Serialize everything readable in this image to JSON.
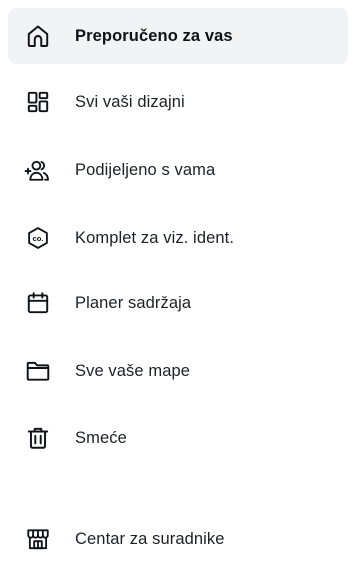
{
  "nav": {
    "items": [
      {
        "label": "Preporučeno za vas",
        "icon": "home-icon",
        "active": true
      },
      {
        "label": "Svi vaši dizajni",
        "icon": "grid-icon",
        "active": false
      },
      {
        "label": "Podijeljeno s vama",
        "icon": "shared-users-icon",
        "active": false
      },
      {
        "label": "Komplet za viz. ident.",
        "icon": "brand-kit-icon",
        "active": false
      },
      {
        "label": "Planer sadržaja",
        "icon": "calendar-icon",
        "active": false
      },
      {
        "label": "Sve vaše mape",
        "icon": "folder-icon",
        "active": false
      },
      {
        "label": "Smeće",
        "icon": "trash-icon",
        "active": false
      },
      {
        "label": "Centar za suradnike",
        "icon": "store-icon",
        "active": false
      }
    ]
  },
  "colors": {
    "active_background": "#f2f3f5",
    "text": "#1c2127",
    "icon_stroke": "#0e1318"
  }
}
